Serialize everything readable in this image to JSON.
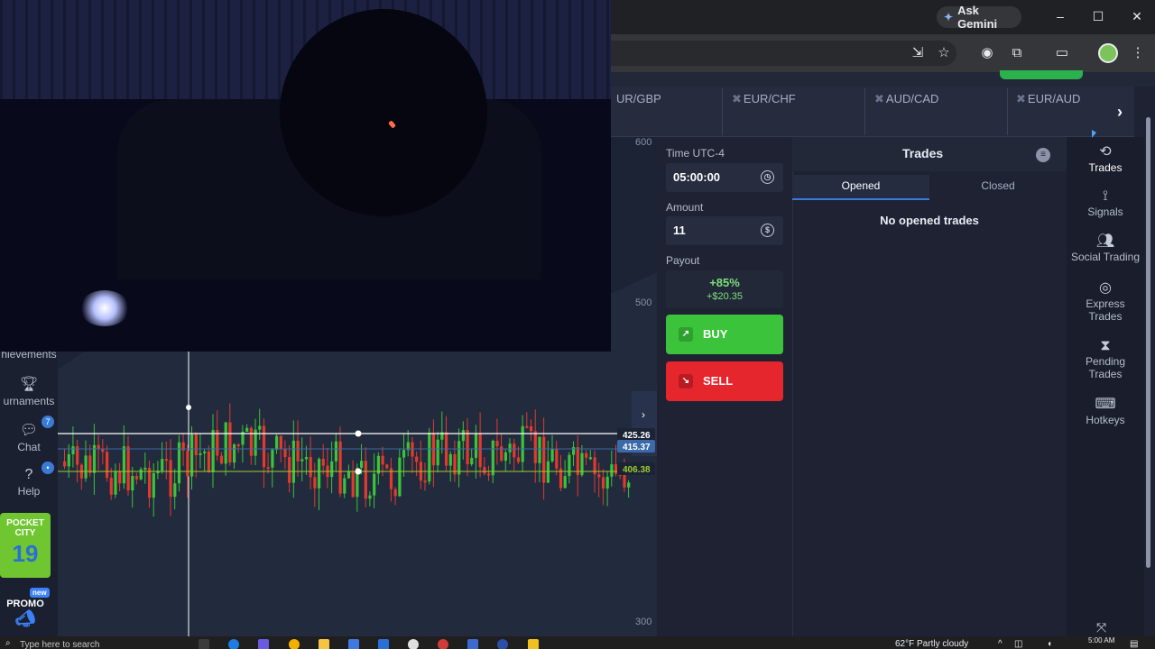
{
  "browser": {
    "gemini_label": "Ask Gemini",
    "minimize": "–",
    "maximize": "☐",
    "close": "✕",
    "toolbar_icons": [
      "install-icon",
      "star-icon",
      "extension-circle-icon",
      "puzzle-icon",
      "cast-icon"
    ]
  },
  "assets": {
    "tabs": [
      "UR/GBP",
      "EUR/CHF",
      "AUD/CAD",
      "EUR/AUD"
    ],
    "close_glyph": "✖",
    "next_glyph": "›"
  },
  "chart": {
    "y_ticks": [
      "600",
      "500",
      "300"
    ],
    "price_labels": {
      "upper": "425.26",
      "current": "415.37",
      "lower": "406.38"
    },
    "collapse_glyph": "›",
    "colors": {
      "up": "#39c43a",
      "down": "#e33a2e",
      "current": "#3a6aa8"
    }
  },
  "sidebar_left": {
    "achievements": "hievements",
    "tournaments": "urnaments",
    "chat": "Chat",
    "chat_badge": "7",
    "help": "Help",
    "pocket_city": "POCKET CITY",
    "pocket_city_num": "19",
    "promo": "PROMO",
    "promo_badge": "new"
  },
  "order": {
    "time_label": "Time UTC-4",
    "time_value": "05:00:00",
    "amount_label": "Amount",
    "amount_value": "11",
    "payout_label": "Payout",
    "payout_pct": "+85%",
    "payout_amount": "+$20.35",
    "buy_label": "BUY",
    "sell_label": "SELL"
  },
  "trades": {
    "title": "Trades",
    "tab_opened": "Opened",
    "tab_closed": "Closed",
    "empty_text": "No opened trades"
  },
  "sidebar_right": {
    "items": [
      {
        "label": "Trades",
        "icon": "history-icon"
      },
      {
        "label": "Signals",
        "icon": "antenna-icon"
      },
      {
        "label": "Social Trading",
        "icon": "users-icon"
      },
      {
        "label": "Express Trades",
        "icon": "target-icon"
      },
      {
        "label": "Pending Trades",
        "icon": "hourglass-icon"
      },
      {
        "label": "Hotkeys",
        "icon": "keyboard-icon"
      }
    ]
  },
  "taskbar": {
    "search_placeholder": "Type here to search",
    "weather": "62°F  Partly cloudy",
    "time": "5:00 AM"
  }
}
